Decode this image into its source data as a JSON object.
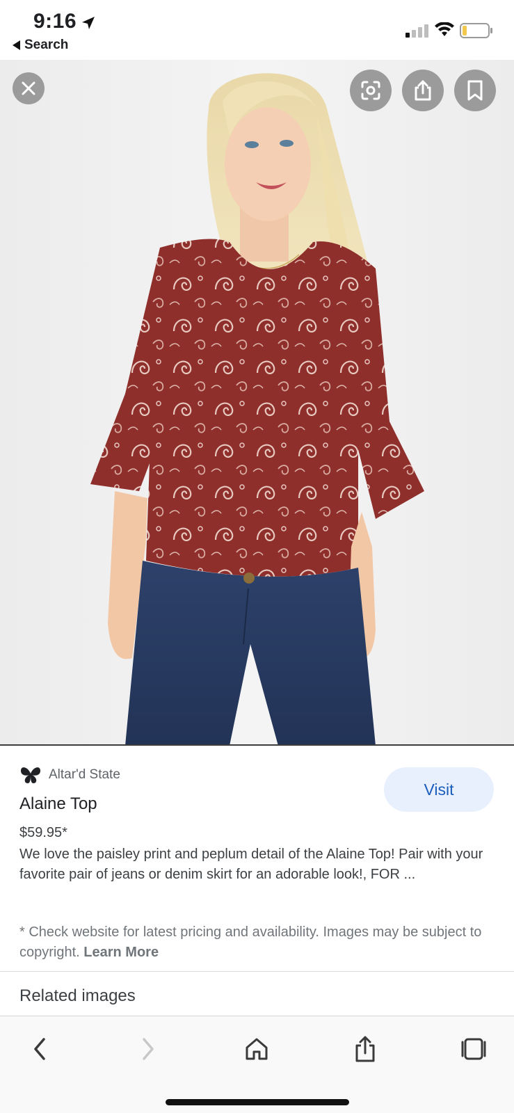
{
  "status_bar": {
    "time": "9:16",
    "back_label": "Search"
  },
  "hero": {
    "image_subject": "woman wearing red paisley peplum top with jeans"
  },
  "product": {
    "source": "Altar'd State",
    "title": "Alaine Top",
    "price": "$59.95*",
    "description": "We love the paisley print and peplum detail of the Alaine Top! Pair with your favorite pair of jeans or denim skirt for an adorable look!, FOR ...",
    "disclaimer": "* Check website for latest pricing and availability. Images may be subject to copyright.",
    "learn_more": "Learn More",
    "visit_label": "Visit"
  },
  "related": {
    "heading": "Related images"
  },
  "colors": {
    "visit_bg": "#e8f0fe",
    "visit_text": "#1a5dbd",
    "top_red": "#8e2f2c",
    "jeans_blue": "#26385c"
  },
  "icons": {
    "close": "close-icon",
    "lens": "lens-icon",
    "share": "share-icon",
    "save": "bookmark-icon",
    "back": "chevron-left-icon",
    "forward": "chevron-right-icon",
    "home": "home-icon",
    "tabs": "tabs-icon"
  }
}
